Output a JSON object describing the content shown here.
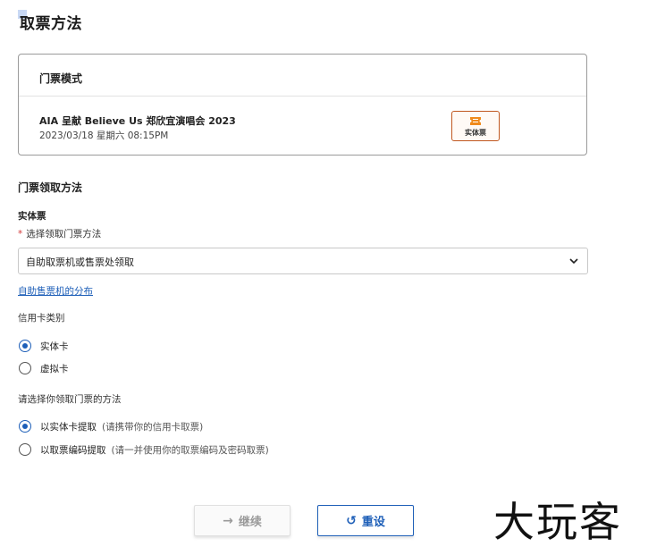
{
  "page": {
    "title": "取票方法"
  },
  "ticket_mode": {
    "header": "门票模式",
    "event_name": "AIA 呈献 Believe Us 郑欣宜演唱会 2023",
    "event_datetime": "2023/03/18 星期六 08:15PM",
    "badge_label": "实体票",
    "badge_icon": "ticket-icon",
    "badge_color": "#c0571f"
  },
  "collection": {
    "section_title": "门票领取方法",
    "ticket_type": "实体票",
    "required_star": "*",
    "method_label": "选择领取门票方法",
    "method_value": "自助取票机或售票处领取",
    "kiosk_link": "自助售票机的分布"
  },
  "card_type": {
    "label": "信用卡类别",
    "options": [
      {
        "label": "实体卡",
        "checked": true
      },
      {
        "label": "虚拟卡",
        "checked": false
      }
    ]
  },
  "pickup_method": {
    "label": "请选择你领取门票的方法",
    "options": [
      {
        "label": "以实体卡提取",
        "note": "(请携带你的信用卡取票)",
        "checked": true
      },
      {
        "label": "以取票编码提取",
        "note": "(请一并使用你的取票编码及密码取票)",
        "checked": false
      }
    ]
  },
  "buttons": {
    "continue_label": "继续",
    "continue_icon": "arrow-right-icon",
    "reset_label": "重设",
    "reset_icon": "refresh-icon"
  },
  "watermark": {
    "text": "大玩客"
  },
  "colors": {
    "accent": "#1e5fb8",
    "required": "#d23b3b"
  }
}
